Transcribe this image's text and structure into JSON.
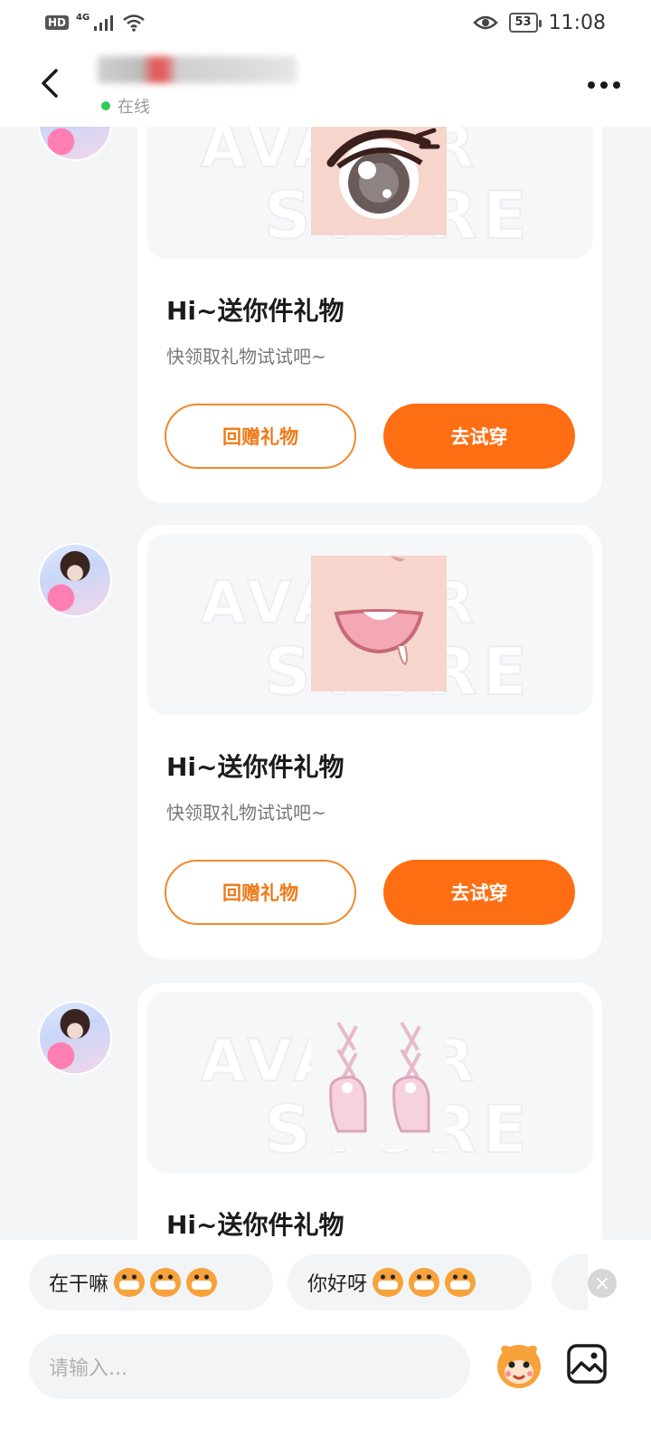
{
  "status_bar": {
    "hd": "HD",
    "network": "4G",
    "battery": "53",
    "time": "11:08"
  },
  "header": {
    "status_text": "在线"
  },
  "messages": [
    {
      "title": "Hi~送你件礼物",
      "subtitle": "快领取礼物试试吧~",
      "return_gift_label": "回赠礼物",
      "try_on_label": "去试穿",
      "watermark_line1": "AVATAR",
      "watermark_line2": "STORE",
      "item": "eye"
    },
    {
      "title": "Hi~送你件礼物",
      "subtitle": "快领取礼物试试吧~",
      "return_gift_label": "回赠礼物",
      "try_on_label": "去试穿",
      "watermark_line1": "AVATAR",
      "watermark_line2": "STORE",
      "item": "mouth"
    },
    {
      "title": "Hi~送你件礼物",
      "watermark_line1": "AVATAR",
      "watermark_line2": "STORE",
      "item": "shoes"
    }
  ],
  "quick_replies": [
    {
      "text": "在干嘛"
    },
    {
      "text": "你好呀"
    }
  ],
  "input": {
    "placeholder": "请输入..."
  },
  "colors": {
    "accent": "#ff6e12",
    "online": "#2ecb58"
  }
}
